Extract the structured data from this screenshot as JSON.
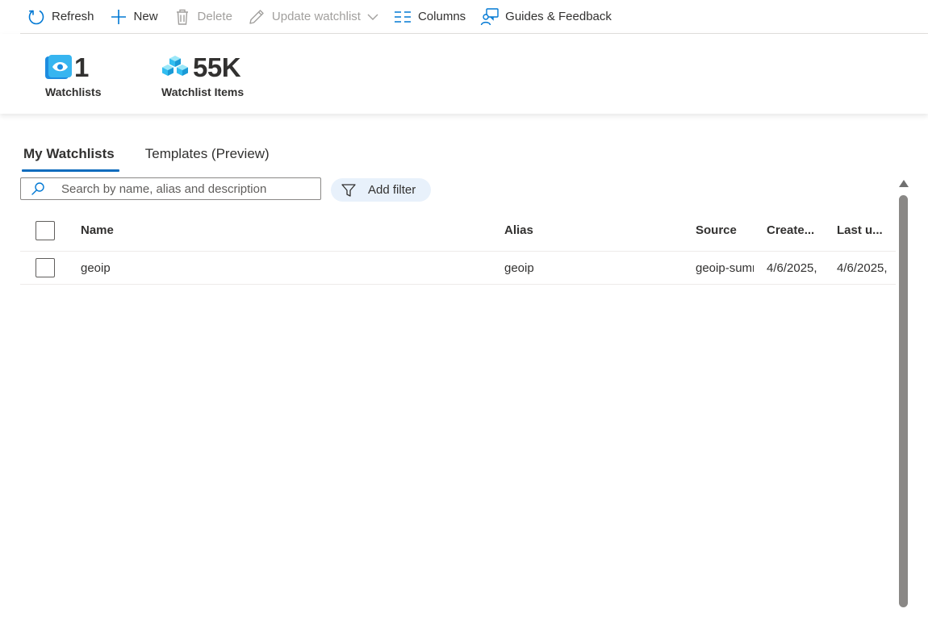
{
  "toolbar": {
    "refresh": "Refresh",
    "new": "New",
    "delete": "Delete",
    "update_watchlist": "Update watchlist",
    "columns": "Columns",
    "guides": "Guides & Feedback"
  },
  "stats": {
    "watchlists": {
      "value": "1",
      "label": "Watchlists"
    },
    "items": {
      "value": "55K",
      "label": "Watchlist Items"
    }
  },
  "tabs": [
    {
      "label": "My Watchlists",
      "active": true
    },
    {
      "label": "Templates (Preview)",
      "active": false
    }
  ],
  "search": {
    "placeholder": "Search by name, alias and description",
    "value": ""
  },
  "filter": {
    "label": "Add filter"
  },
  "grid": {
    "columns": [
      "Name",
      "Alias",
      "Source",
      "Create...",
      "Last u..."
    ],
    "rows": [
      {
        "name": "geoip",
        "alias": "geoip",
        "source": "geoip-summarized.csv",
        "created": "4/6/2025,",
        "last_updated": "4/6/2025,"
      }
    ]
  },
  "colors": {
    "accent": "#0f6cbd",
    "icon_blue": "#0078d4",
    "disabled": "#a19f9d"
  }
}
